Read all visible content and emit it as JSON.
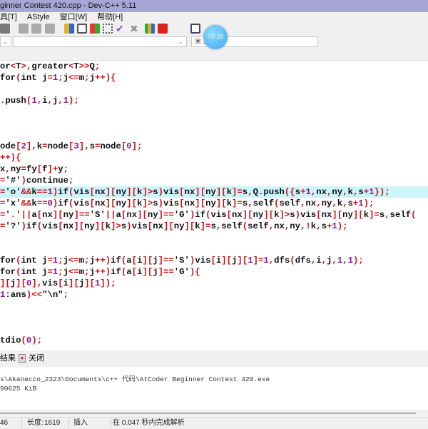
{
  "window": {
    "title": "ginner Contest 420.cpp - Dev-C++ 5.11"
  },
  "menu": [
    "具[T]",
    "AStyle",
    "窗口[W]",
    "帮助[H]"
  ],
  "combo": {
    "right_value": "⌘ 1"
  },
  "overlay": {
    "timer": "73:38"
  },
  "editor": {
    "highlight_line": 11,
    "lines": [
      "or<T>,greater<T>>Q;",
      "for(int j=1;j<=m;j++){",
      "",
      ".push(1,i,j,1);",
      "",
      "",
      "",
      "ode[2],k=node[3],s=node[0];",
      "++){",
      "x,ny=fy[f]+y;",
      "='#')continue;",
      "='o'&&k==1)if(vis[nx][ny][k]>s)vis[nx][ny][k]=s,Q.push({s+1,nx,ny,k,s+1});",
      "='x'&&k==0)if(vis[nx][ny][k]>s)vis[nx][ny][k]=s,self(self,nx,ny,k,s+1);",
      "='.'||a[nx][ny]=='S'||a[nx][ny]=='G')if(vis[nx][ny][k]>s)vis[nx][ny][k]=s,self(",
      "='?')if(vis[nx][ny][k]>s)vis[nx][ny][k]=s,self(self,nx,ny,!k,s+1);",
      "",
      "",
      "for(int j=1;j<=m;j++)if(a[i][j]=='S')vis[i][j][1]=1,dfs(dfs,i,j,1,1);",
      "for(int j=1;j<=m;j++)if(a[i][j]=='G'){",
      "][j][0],vis[i][j][1]);",
      "1:ans)<<\"\\n\";",
      "",
      "",
      "",
      "tdio(0);"
    ]
  },
  "panel": {
    "tab_result": "结果",
    "tab_close": "关闭"
  },
  "output": {
    "lines": [
      "s\\Akanecco_2323\\Documents\\c++ 代码\\AtCoder Beginner Contest 420.exe",
      "90625 KiB"
    ]
  },
  "status": {
    "line": "46",
    "length_label": "长度:",
    "length": "1619",
    "mode": "插入",
    "parse": "在 0.047 秒内完成解析"
  }
}
